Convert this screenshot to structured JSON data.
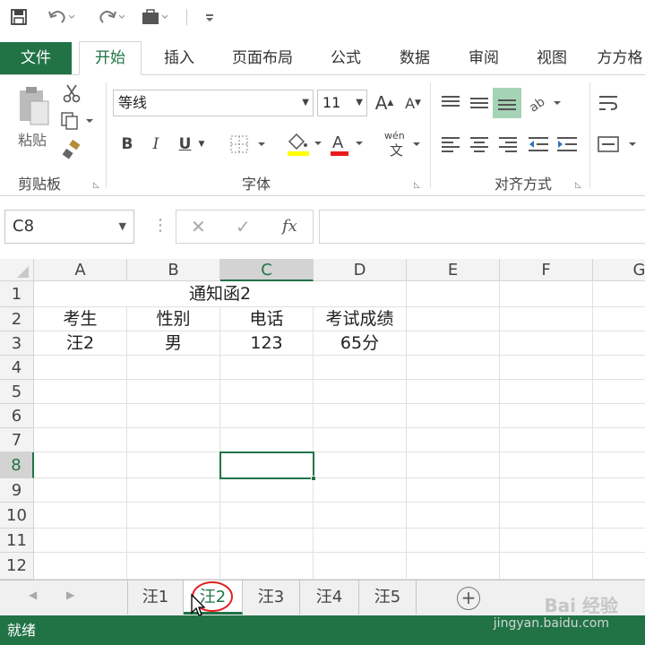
{
  "qat": {
    "save_icon": "save-icon",
    "undo_icon": "undo-icon",
    "redo_icon": "redo-icon",
    "briefcase_icon": "briefcase-icon",
    "customize_icon": "customize-icon"
  },
  "tabs": [
    {
      "label": "文件"
    },
    {
      "label": "开始"
    },
    {
      "label": "插入"
    },
    {
      "label": "页面布局"
    },
    {
      "label": "公式"
    },
    {
      "label": "数据"
    },
    {
      "label": "审阅"
    },
    {
      "label": "视图"
    },
    {
      "label": "方方格"
    }
  ],
  "ribbon": {
    "clipboard": {
      "label": "剪贴板",
      "paste": "粘贴"
    },
    "font": {
      "label": "字体",
      "font_name": "等线",
      "font_size": "11",
      "bold": "B",
      "italic": "I",
      "underline": "U",
      "font_color_letter": "A",
      "phonetic": "wén"
    },
    "alignment": {
      "label": "对齐方式"
    }
  },
  "formula_bar": {
    "name_box": "C8",
    "fx": "fx",
    "cancel": "✕",
    "enter": "✓",
    "content": ""
  },
  "columns": [
    "A",
    "B",
    "C",
    "D",
    "E",
    "F",
    "G"
  ],
  "rows": [
    "1",
    "2",
    "3",
    "4",
    "5",
    "6",
    "7",
    "8",
    "9",
    "10",
    "11",
    "12"
  ],
  "cells": {
    "title": "通知函2",
    "headers": [
      "考生",
      "性别",
      "电话",
      "考试成绩"
    ],
    "row3": [
      "汪2",
      "男",
      "123",
      "65分"
    ]
  },
  "selected_cell": "C8",
  "sheets": [
    "汪1",
    "汪2",
    "汪3",
    "汪4",
    "汪5"
  ],
  "active_sheet": "汪2",
  "status": "就绪",
  "watermark": {
    "brand": "Bai 经验",
    "url": "jingyan.baidu.com"
  },
  "colors": {
    "accent": "#217346",
    "annotation": "#e02020"
  }
}
